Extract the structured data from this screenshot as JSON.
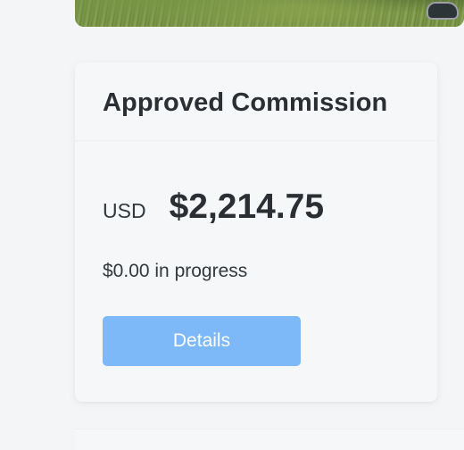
{
  "card": {
    "title": "Approved Commission",
    "currency": "USD",
    "amount": "$2,214.75",
    "in_progress": "$0.00 in progress",
    "details_label": "Details"
  },
  "colors": {
    "button_bg": "#7db9f9",
    "page_bg": "#f4f5f7",
    "text": "#2b2f33"
  }
}
